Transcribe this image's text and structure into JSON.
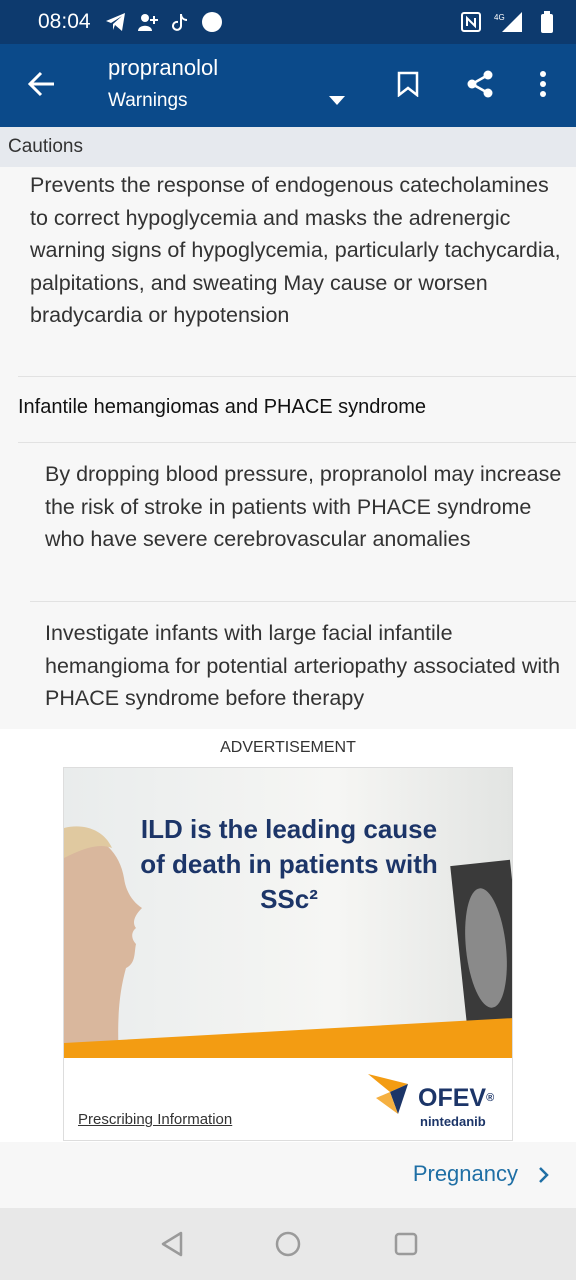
{
  "status_bar": {
    "time": "08:04",
    "left_icons": [
      "telegram-icon",
      "add-contact-icon",
      "tiktok-icon",
      "circle-icon"
    ],
    "right_icons": [
      "nfc-icon",
      "signal-4g-icon",
      "battery-icon"
    ],
    "network_label": "4G"
  },
  "app_bar": {
    "title": "propranolol",
    "subtitle": "Warnings",
    "colors": {
      "background": "#0b4a8a",
      "status": "#0d3a6e"
    }
  },
  "section_header": "Cautions",
  "content": {
    "paragraph1": "Prevents the response of endogenous catecholamines to correct hypoglycemia and masks the adrenergic warning signs of hypoglycemia, particularly tachycardia, palpitations, and sweating May cause or worsen bradycardia or hypotension",
    "subheading": "Infantile hemangiomas and PHACE syndrome",
    "paragraph2": "By dropping blood pressure, propranolol may increase the risk of stroke in patients with PHACE syndrome who have severe cerebrovascular anomalies",
    "paragraph3": "Investigate infants with large facial infantile hemangioma for potential arteriopathy associated with PHACE syndrome before therapy"
  },
  "advertisement": {
    "label": "ADVERTISEMENT",
    "headline": "ILD is the leading cause of death in patients with SSc²",
    "link": "Prescribing Information",
    "brand": "OFEV",
    "brand_mark": "®",
    "brand_sub": "nintedanib",
    "colors": {
      "headline": "#1c3568",
      "accent": "#f39c12"
    }
  },
  "next_section": {
    "label": "Pregnancy",
    "color": "#1f6fa5"
  },
  "nav_bar": {
    "buttons": [
      "back-icon",
      "home-icon",
      "recents-icon"
    ]
  }
}
